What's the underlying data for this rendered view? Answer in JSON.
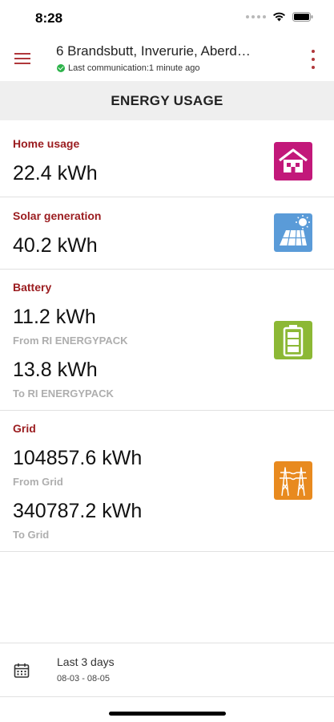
{
  "status_bar": {
    "time": "8:28"
  },
  "header": {
    "address": "6 Brandsbutt, Inverurie, Aberd…",
    "communication": "Last communication:1 minute ago"
  },
  "page_title": "ENERGY USAGE",
  "home": {
    "title": "Home usage",
    "value": "22.4 kWh",
    "icon": "house-icon"
  },
  "solar": {
    "title": "Solar generation",
    "value": "40.2 kWh",
    "icon": "solar-panel-icon"
  },
  "battery": {
    "title": "Battery",
    "from_value": "11.2 kWh",
    "from_label": "From RI ENERGYPACK",
    "to_value": "13.8 kWh",
    "to_label": "To RI ENERGYPACK",
    "icon": "battery-icon"
  },
  "grid": {
    "title": "Grid",
    "from_value": "104857.6 kWh",
    "from_label": "From Grid",
    "to_value": "340787.2 kWh",
    "to_label": "To Grid",
    "icon": "power-pylon-icon"
  },
  "date_range": {
    "label": "Last 3 days",
    "dates": "08-03 - 08-05",
    "icon": "calendar-icon"
  },
  "colors": {
    "accent": "#9b1d20",
    "home_icon": "#c2187a",
    "solar_icon": "#5a9bd8",
    "battery_icon": "#8cb835",
    "grid_icon": "#e88a1f"
  }
}
